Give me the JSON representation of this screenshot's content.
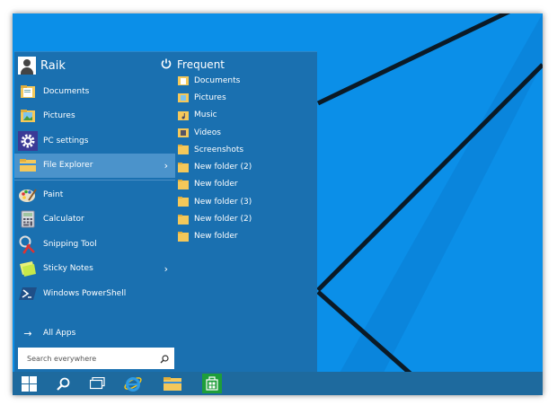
{
  "user": {
    "name": "Raik"
  },
  "frequent": {
    "title": "Frequent"
  },
  "apps": [
    {
      "label": "Documents",
      "icon": "documents-folder-icon"
    },
    {
      "label": "Pictures",
      "icon": "pictures-folder-icon"
    },
    {
      "label": "PC settings",
      "icon": "gear-icon"
    },
    {
      "label": "File Explorer",
      "icon": "file-explorer-icon",
      "selected": true,
      "chevron": "›"
    },
    {
      "label": "Paint",
      "icon": "paint-icon"
    },
    {
      "label": "Calculator",
      "icon": "calculator-icon"
    },
    {
      "label": "Snipping Tool",
      "icon": "scissors-icon"
    },
    {
      "label": "Sticky Notes",
      "icon": "sticky-notes-icon",
      "chevron": "›"
    },
    {
      "label": "Windows PowerShell",
      "icon": "powershell-icon"
    }
  ],
  "all_apps": {
    "label": "All Apps",
    "arrow": "→"
  },
  "search": {
    "placeholder": "Search everywhere"
  },
  "frequent_items": [
    "Documents",
    "Pictures",
    "Music",
    "Videos",
    "Screenshots",
    "New folder (2)",
    "New folder",
    "New folder (3)",
    "New folder (2)",
    "New folder"
  ],
  "taskbar": {
    "icons": [
      "windows-logo-icon",
      "search-icon",
      "task-view-icon",
      "internet-explorer-icon",
      "file-explorer-icon",
      "store-icon"
    ]
  },
  "colors": {
    "desktop": "#0b8fe8",
    "start_menu": "#1a70b0",
    "selected": "#4b93cb",
    "taskbar": "#1e6a9e"
  }
}
